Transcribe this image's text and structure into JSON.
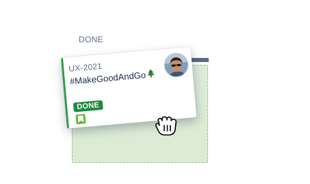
{
  "column": {
    "header": "DONE"
  },
  "card": {
    "key": "UX-2021",
    "summary": "#MakeGoodAndGo",
    "summary_icon": "evergreen-tree-icon",
    "status": "DONE",
    "issue_type_icon": "story-icon",
    "assignee_avatar": "avatar",
    "colors": {
      "status_bg": "#1f8a3f",
      "left_bar": "#2c9b48",
      "story_icon": "#63ba3c"
    }
  },
  "drop_zone": {
    "fill": "#dcebd5",
    "border": "#9bc08a"
  },
  "cursor": {
    "type": "grabbing-hand-icon"
  }
}
